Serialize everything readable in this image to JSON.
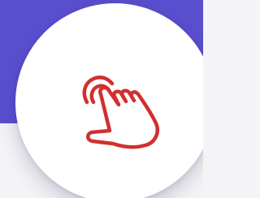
{
  "feature": {
    "icon": "tap-hand-icon",
    "accent_color": "#d22f2f",
    "background_color": "#5a4fcf"
  }
}
